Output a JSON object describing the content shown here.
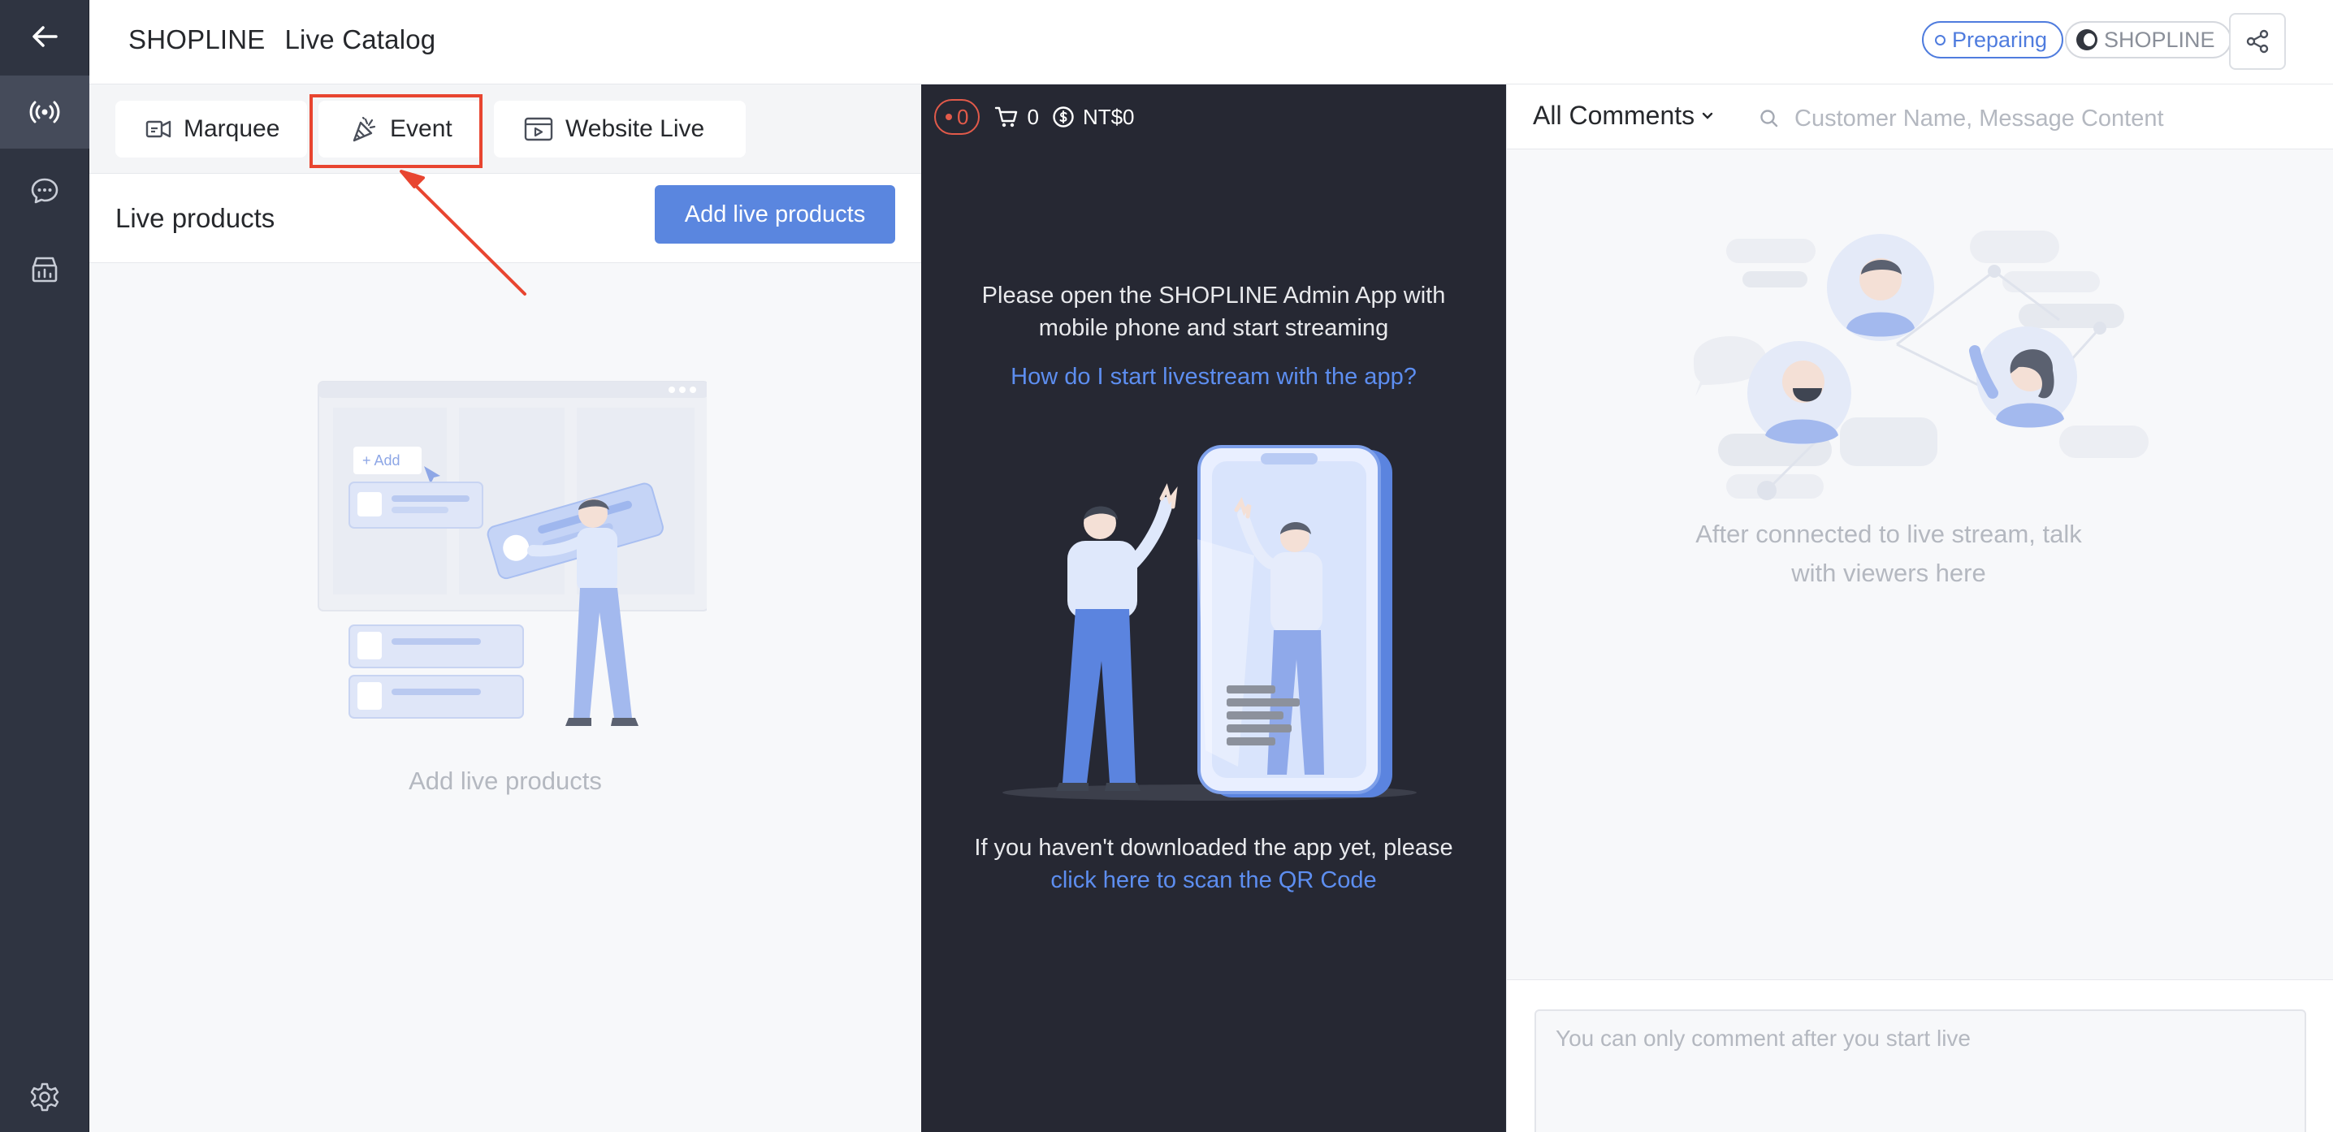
{
  "header": {
    "brand": "SHOPLINE",
    "title": "Live Catalog",
    "status": "Preparing",
    "shop_badge": "SHOPLINE"
  },
  "tabs": [
    {
      "label": "Marquee",
      "icon": "marquee-icon"
    },
    {
      "label": "Event",
      "icon": "party-popper-icon"
    },
    {
      "label": "Website Live",
      "icon": "browser-live-icon"
    }
  ],
  "live_products": {
    "title": "Live products",
    "add_button": "Add live products",
    "empty_text": "Add live products",
    "illustration_add_label": "+ Add"
  },
  "stream": {
    "live_count": "0",
    "cart_count": "0",
    "revenue": "NT$0",
    "message": "Please open the SHOPLINE Admin App with mobile phone and start streaming",
    "help_link": "How do I start livestream with the app?",
    "footer_text": "If you haven't downloaded the app yet, please",
    "qr_link": "click here to scan the QR Code"
  },
  "comments": {
    "filter_label": "All Comments",
    "search_placeholder": "Customer Name, Message Content",
    "empty_text": "After connected to live stream, talk with viewers here",
    "input_placeholder": "You can only comment after you start live"
  },
  "colors": {
    "accent": "#5a86df",
    "rail": "#2f3441",
    "stream_bg": "#262833",
    "highlight": "#e84530",
    "live_red": "#e25a4a"
  }
}
